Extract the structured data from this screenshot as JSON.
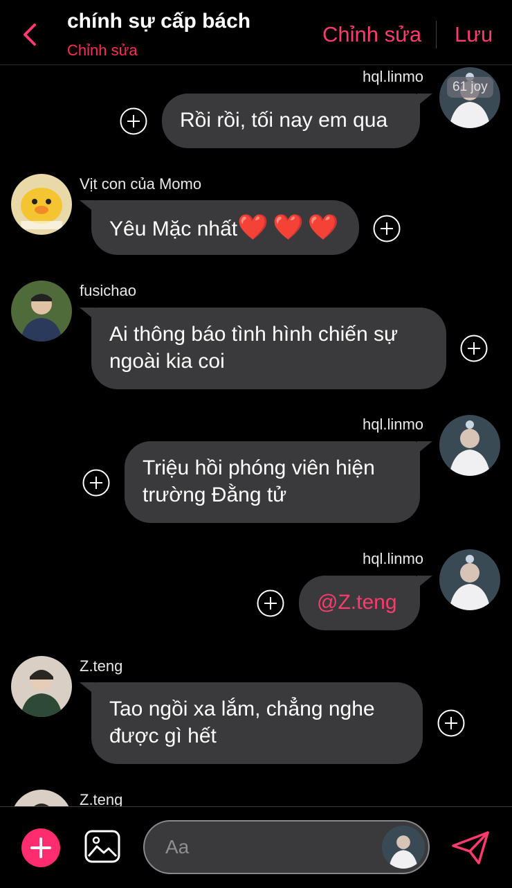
{
  "header": {
    "title": "chính sự cấp bách",
    "subtitle": "Chỉnh sửa",
    "edit_label": "Chỉnh sửa",
    "save_label": "Lưu"
  },
  "messages": [
    {
      "sender": "hql.linmo",
      "text": "Rồi rồi, tối nay em qua",
      "side": "right",
      "badge": "61 joy"
    },
    {
      "sender": "Vịt con của Momo",
      "text": "Yêu Mặc nhất",
      "emoji": "❤️❤️❤️",
      "side": "left"
    },
    {
      "sender": "fusichao",
      "lines": [
        "Ai thông báo tình hình chiến sự",
        "ngoài kia coi"
      ],
      "side": "left"
    },
    {
      "sender": "hql.linmo",
      "lines": [
        "Triệu hồi phóng viên hiện",
        "trường Đằng tử"
      ],
      "side": "right"
    },
    {
      "sender": "hql.linmo",
      "text": "@Z.teng",
      "side": "right",
      "mention": true
    },
    {
      "sender": "Z.teng",
      "lines": [
        "Tao ngồi xa lắm, chẳng nghe",
        "được gì hết"
      ],
      "side": "left"
    },
    {
      "sender": "Z.teng",
      "side": "left"
    }
  ],
  "composer": {
    "placeholder": "Aa"
  },
  "colors": {
    "accent": "#ff3b6e",
    "bubble": "#3a3a3c",
    "background": "#000000"
  },
  "icons": [
    "back-chevron-icon",
    "add-reaction-icon",
    "plus-icon",
    "image-icon",
    "send-icon"
  ]
}
